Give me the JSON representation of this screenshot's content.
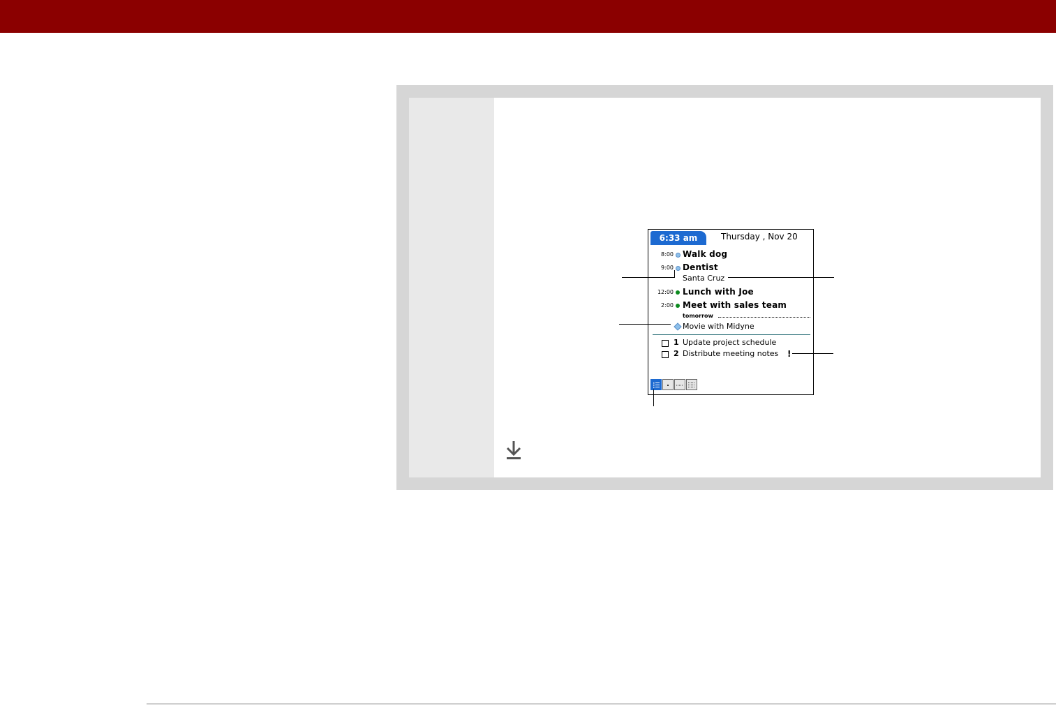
{
  "colors": {
    "header_bar": "#8b0000",
    "panel_frame": "#d6d6d6",
    "panel_side": "#e9e9e9",
    "clock_blue": "#1d6ad1",
    "timed_dot_blue": "#8ec0ea",
    "timed_dot_green": "#0b8a1e"
  },
  "screen": {
    "clock": "6:33 am",
    "date": "Thursday , Nov 20",
    "events": [
      {
        "time": "8:00",
        "title": "Walk dog",
        "dot": "blue"
      },
      {
        "time": "9:00",
        "title": "Dentist",
        "dot": "blue",
        "location": "Santa Cruz"
      },
      {
        "time": "12:00",
        "title": "Lunch with Joe",
        "dot": "green"
      },
      {
        "time": "2:00",
        "title": "Meet with sales team",
        "dot": "green"
      }
    ],
    "tomorrow_label": "tomorrow",
    "untimed_event": "Movie with Midyne",
    "tasks": [
      {
        "priority": "1",
        "title": "Update project schedule"
      },
      {
        "priority": "2",
        "title": "Distribute meeting notes",
        "flag": "!"
      }
    ],
    "view_buttons": [
      "agenda-view",
      "day-view",
      "week-view",
      "month-view"
    ]
  },
  "icons": {
    "download": "download-arrow-icon"
  }
}
